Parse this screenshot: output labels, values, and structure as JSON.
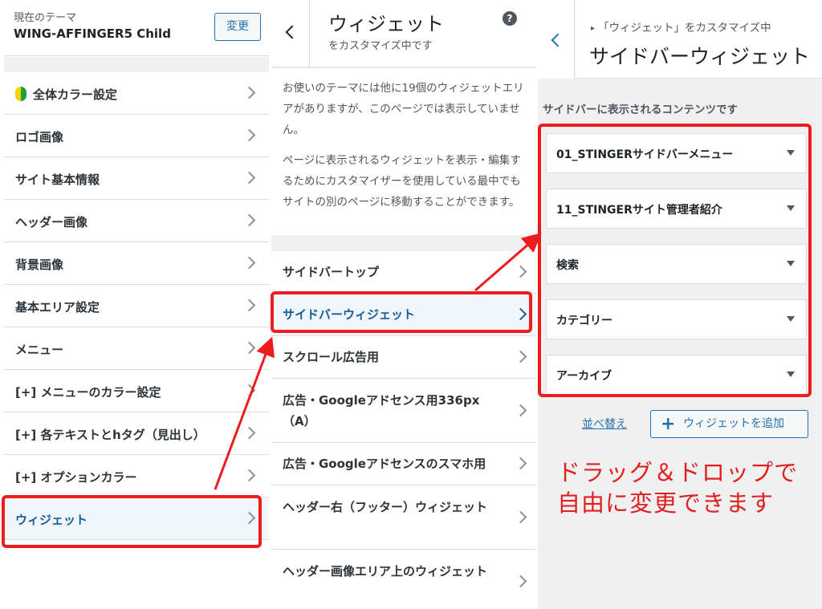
{
  "panel_theme": {
    "current_theme_label": "現在のテーマ",
    "theme_name": "WING-AFFINGER5 Child",
    "change_button": "変更",
    "items": [
      {
        "label": "全体カラー設定",
        "icon": "beginner-leaf-icon"
      },
      {
        "label": "ロゴ画像"
      },
      {
        "label": "サイト基本情報"
      },
      {
        "label": "ヘッダー画像"
      },
      {
        "label": "背景画像"
      },
      {
        "label": "基本エリア設定"
      },
      {
        "label": "メニュー"
      },
      {
        "label": "[+] メニューのカラー設定"
      },
      {
        "label": "[+] 各テキストとhタグ（見出し）"
      },
      {
        "label": "[+] オプションカラー"
      },
      {
        "label": "ウィジェット"
      }
    ]
  },
  "panel_widgets": {
    "title": "ウィジェット",
    "subtitle": "をカスタマイズ中です",
    "help_icon": "?",
    "description": [
      "お使いのテーマには他に19個のウィジェットエリアがありますが、このページでは表示していません。",
      "ページに表示されるウィジェットを表示・編集するためにカスタマイザーを使用している最中でもサイトの別のページに移動することができます。"
    ],
    "areas": [
      {
        "label": "サイドバートップ"
      },
      {
        "label": "サイドバーウィジェット"
      },
      {
        "label": "スクロール広告用"
      },
      {
        "label": "広告・Googleアドセンス用336px（A）"
      },
      {
        "label": "広告・Googleアドセンスのスマホ用"
      },
      {
        "label": "ヘッダー右（フッター）ウィジェット"
      },
      {
        "label": "ヘッダー画像エリア上のウィジェット"
      }
    ]
  },
  "panel_sidebar": {
    "breadcrumb": "「ウィジェット」をカスタマイズ中",
    "title": "サイドバーウィジェット",
    "section_description": "サイドバーに表示されるコンテンツです",
    "widgets": [
      {
        "label": "01_STINGERサイドバーメニュー"
      },
      {
        "label": "11_STINGERサイト管理者紹介"
      },
      {
        "label": "検索"
      },
      {
        "label": "カテゴリー"
      },
      {
        "label": "アーカイブ"
      }
    ],
    "reorder_link": "並べ替え",
    "add_widget_button": "ウィジェットを追加"
  },
  "annotation": {
    "lines": [
      "ドラッグ＆ドロップで",
      "自由に変更できます"
    ],
    "color": "#e02020"
  },
  "colors": {
    "link_blue": "#2271b1",
    "highlight_red": "#ee1c1c",
    "background_gray": "#f0f0f1"
  }
}
